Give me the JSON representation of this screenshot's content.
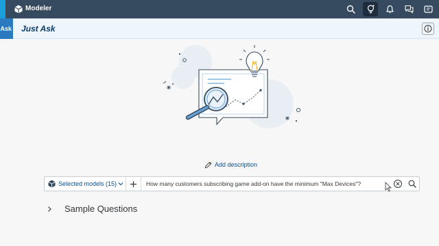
{
  "shell": {
    "app_title": "Modeler",
    "icons": [
      "search-icon",
      "lightbulb-icon",
      "bell-icon",
      "feedback-icon",
      "help-icon"
    ]
  },
  "subheader": {
    "tab_label": "Ask",
    "title": "Just Ask",
    "info_icon": "info-icon"
  },
  "main": {
    "add_description_label": "Add description",
    "query": {
      "model_selector_label": "Selected models (15)",
      "question": "How many customers subscribing game add-on have the minimum \"Max Devices\"?"
    },
    "sample_questions_label": "Sample Questions"
  },
  "colors": {
    "shell_bg": "#354a5f",
    "accent": "#0a4f8f",
    "subheader_bg": "#eef5fb"
  }
}
